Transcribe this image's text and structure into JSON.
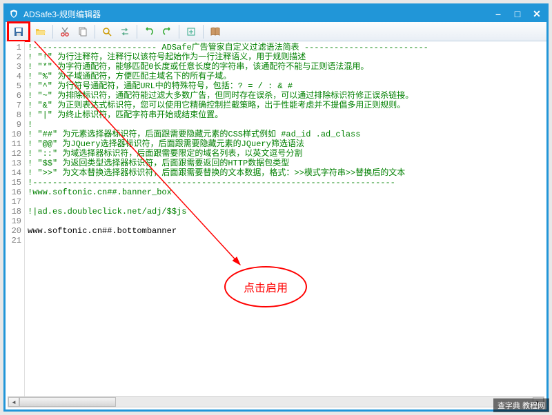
{
  "titlebar": {
    "title": "ADSafe3-规则编辑器"
  },
  "toolbar": {
    "save": "save",
    "open": "open",
    "cut": "cut",
    "copy": "copy",
    "find": "find",
    "replace": "replace",
    "undo": "undo",
    "redo": "redo",
    "export": "export",
    "book": "book"
  },
  "editor": {
    "lines": [
      {
        "n": 1,
        "green": true,
        "text": "!------------------------- ADSafe广告管家自定义过滤语法简表 -------------------------"
      },
      {
        "n": 2,
        "green": true,
        "text": "! \"!\" 为行注释符，注释行以该符号起始作为一行注释语义，用于规则描述"
      },
      {
        "n": 3,
        "green": true,
        "text": "! \"*\" 为字符通配符，能够匹配0长度或任意长度的字符串，该通配符不能与正则语法混用。"
      },
      {
        "n": 4,
        "green": true,
        "text": "! \"%\" 为子域通配符，方便匹配主域名下的所有子域。"
      },
      {
        "n": 5,
        "green": true,
        "text": "! \"^\" 为行符号通配符，通配URL中的特殊符号，包括：? = / : & #"
      },
      {
        "n": 6,
        "green": true,
        "text": "! \"~\" 为排除标识符，通配符能过滤大多数广告，但同时存在误杀，可以通过排除标识符修正误杀链接。"
      },
      {
        "n": 7,
        "green": true,
        "text": "! \"&\" 为正则表达式标识符，您可以使用它精确控制拦截策略，出于性能考虑并不提倡多用正则规则。"
      },
      {
        "n": 8,
        "green": true,
        "text": "! \"|\" 为终止标识符，匹配字符串开始或结束位置。"
      },
      {
        "n": 9,
        "green": true,
        "text": "!"
      },
      {
        "n": 10,
        "green": true,
        "text": "! \"##\" 为元素选择器标识符，后面跟需要隐藏元素的CSS样式例如 #ad_id .ad_class"
      },
      {
        "n": 11,
        "green": true,
        "text": "! \"@@\" 为JQuery选择器标识符，后面跟需要隐藏元素的JQuery筛选语法"
      },
      {
        "n": 12,
        "green": true,
        "text": "! \"::\" 为域选择器标识符，后面跟需要限定的域名列表，以英文逗号分割"
      },
      {
        "n": 13,
        "green": true,
        "text": "! \"$$\" 为返回类型选择器标识符，后面跟需要返回的HTTP数据包类型"
      },
      {
        "n": 14,
        "green": true,
        "text": "! \">>\" 为文本替换选择器标识符，后面跟需要替换的文本数据，格式：>>模式字符串>>替换后的文本"
      },
      {
        "n": 15,
        "green": true,
        "text": "!-------------------------------------------------------------------------"
      },
      {
        "n": 16,
        "green": true,
        "text": "!www.softonic.cn##.banner_box"
      },
      {
        "n": 17,
        "green": true,
        "text": ""
      },
      {
        "n": 18,
        "green": true,
        "text": "!|ad.es.doubleclick.net/adj/$$js"
      },
      {
        "n": 19,
        "green": true,
        "text": ""
      },
      {
        "n": 20,
        "green": false,
        "text": "www.softonic.cn##.bottombanner"
      },
      {
        "n": 21,
        "green": false,
        "text": ""
      }
    ]
  },
  "annotation": {
    "bubble_text": "点击启用"
  },
  "watermark": "查字典 教程网"
}
